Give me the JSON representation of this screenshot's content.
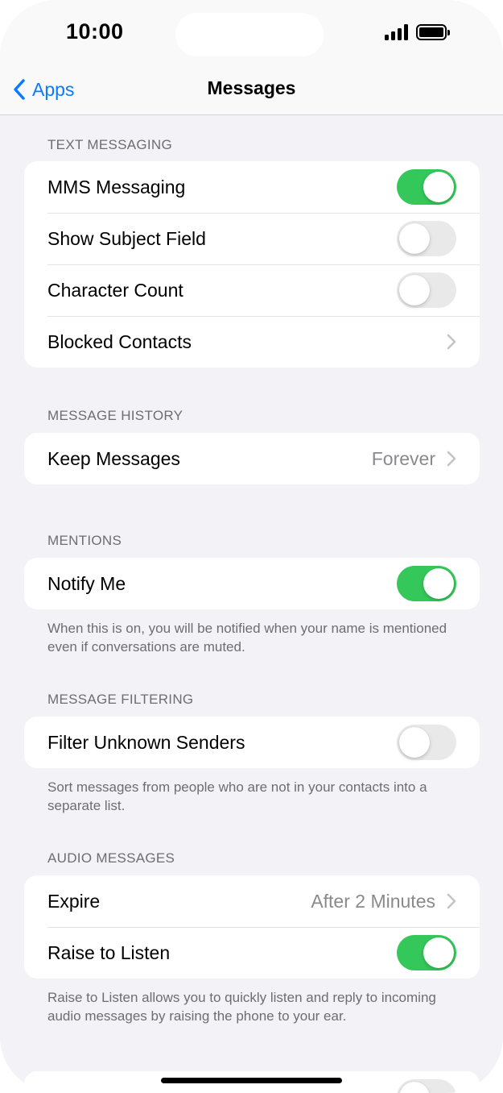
{
  "status_bar": {
    "time": "10:00",
    "signal_icon": "cellular-signal-icon",
    "battery_icon": "battery-full-icon"
  },
  "nav": {
    "back_label": "Apps",
    "back_icon": "chevron-left-icon",
    "title": "Messages",
    "accent": "#0A7AFF"
  },
  "sections": {
    "text_messaging": {
      "header": "TEXT MESSAGING",
      "mms": {
        "label": "MMS Messaging",
        "on": true
      },
      "subject": {
        "label": "Show Subject Field",
        "on": false
      },
      "char_count": {
        "label": "Character Count",
        "on": false
      },
      "blocked": {
        "label": "Blocked Contacts"
      }
    },
    "message_history": {
      "header": "MESSAGE HISTORY",
      "keep": {
        "label": "Keep Messages",
        "value": "Forever"
      }
    },
    "mentions": {
      "header": "MENTIONS",
      "notify": {
        "label": "Notify Me",
        "on": true
      },
      "footer": "When this is on, you will be notified when your name is mentioned even if conversations are muted."
    },
    "message_filtering": {
      "header": "MESSAGE FILTERING",
      "filter": {
        "label": "Filter Unknown Senders",
        "on": false
      },
      "footer": "Sort messages from people who are not in your contacts into a separate list."
    },
    "audio_messages": {
      "header": "AUDIO MESSAGES",
      "expire": {
        "label": "Expire",
        "value": "After 2 Minutes"
      },
      "raise": {
        "label": "Raise to Listen",
        "on": true
      },
      "footer": "Raise to Listen allows you to quickly listen and reply to incoming audio messages by raising the phone to your ear."
    }
  },
  "colors": {
    "toggle_on": "#34C759",
    "toggle_off": "#E9E9EA",
    "background": "#F2F2F7"
  }
}
